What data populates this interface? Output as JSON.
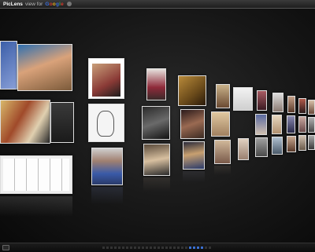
{
  "titlebar": {
    "app_name": "PicLens",
    "view_for": "view for",
    "provider_letters": [
      "G",
      "o",
      "o",
      "g",
      "l",
      "e"
    ]
  },
  "colors": {
    "background": "#161616",
    "active_scroll": "#3a6fd0"
  },
  "wall": {
    "image_icon": "photo-thumbnail",
    "rows": 3,
    "columns_visible": 12
  }
}
